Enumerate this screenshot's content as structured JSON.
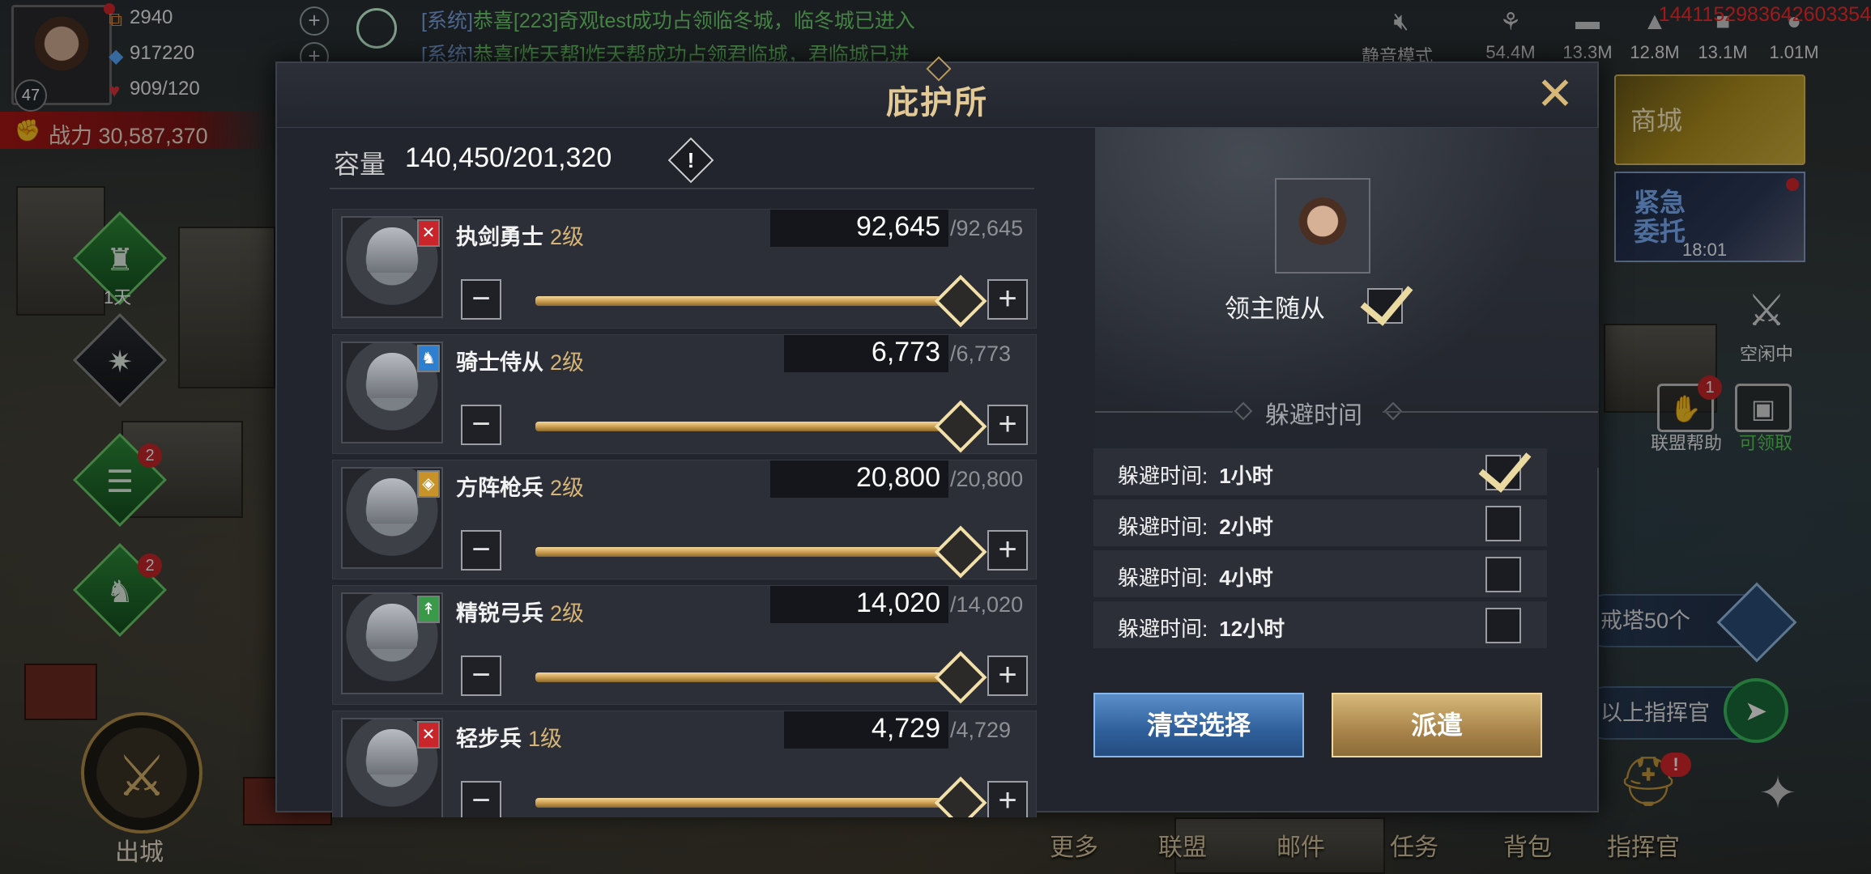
{
  "player": {
    "level": "47",
    "resources": [
      "2940",
      "917220",
      "909/120"
    ],
    "power": "战力 30,587,370"
  },
  "chat": {
    "lines": [
      {
        "tag": "[系统]",
        "text": "恭喜[223]奇观test成功占领临冬城，临冬城已进入"
      },
      {
        "tag": "[系统]",
        "text": "恭喜[炸天帮]炸天帮成功占领君临城，君临城已进"
      }
    ]
  },
  "topbar": {
    "mute_label": "静音模式",
    "resources": [
      "54.4M",
      "13.3M",
      "12.8M",
      "13.1M",
      "1.01M"
    ],
    "server_id": "1441152983642603354"
  },
  "left_side": {
    "timer_label": "1天",
    "badges": [
      "2",
      "2"
    ],
    "out_city_label": "出城"
  },
  "right_side": {
    "shop_label": "商城",
    "urgent_label": "紧急委托",
    "urgent_time": "18:01",
    "idle_label": "空闲中",
    "alliance_help_label": "联盟帮助",
    "alliance_help_badge": "1",
    "claimable_label": "可领取",
    "quest_1": "戒塔50个",
    "quest_2": "以上指挥官",
    "commander_badge": "!"
  },
  "bottom_nav": [
    "更多",
    "联盟",
    "邮件",
    "任务",
    "背包",
    "指挥官"
  ],
  "modal": {
    "title": "庇护所",
    "capacity_label": "容量",
    "capacity_value": "140,450/201,320",
    "info_icon": "!",
    "troops": [
      {
        "name": "执剑勇士",
        "level": "2级",
        "count": "92,645",
        "max": "/92,645",
        "fill": 1.0,
        "badge_color": "#c8262b",
        "badge_icon": "✕"
      },
      {
        "name": "骑士侍从",
        "level": "2级",
        "count": "6,773",
        "max": "/6,773",
        "fill": 1.0,
        "badge_color": "#2f7fd0",
        "badge_icon": "♞"
      },
      {
        "name": "方阵枪兵",
        "level": "2级",
        "count": "20,800",
        "max": "/20,800",
        "fill": 1.0,
        "badge_color": "#c8922b",
        "badge_icon": "◈"
      },
      {
        "name": "精锐弓兵",
        "level": "2级",
        "count": "14,020",
        "max": "/14,020",
        "fill": 1.0,
        "badge_color": "#3a9a4a",
        "badge_icon": "↟"
      },
      {
        "name": "轻步兵",
        "level": "1级",
        "count": "4,729",
        "max": "/4,729",
        "fill": 1.0,
        "badge_color": "#c8262b",
        "badge_icon": "✕"
      }
    ],
    "lord_follow_label": "领主随从",
    "lord_follow_checked": true,
    "hide_time_title": "躲避时间",
    "hide_options": [
      {
        "label": "躲避时间:",
        "value": "1小时",
        "checked": true
      },
      {
        "label": "躲避时间:",
        "value": "2小时",
        "checked": false
      },
      {
        "label": "躲避时间:",
        "value": "4小时",
        "checked": false
      },
      {
        "label": "躲避时间:",
        "value": "12小时",
        "checked": false
      }
    ],
    "clear_button": "清空选择",
    "dispatch_button": "派遣",
    "close_icon": "close-icon"
  }
}
